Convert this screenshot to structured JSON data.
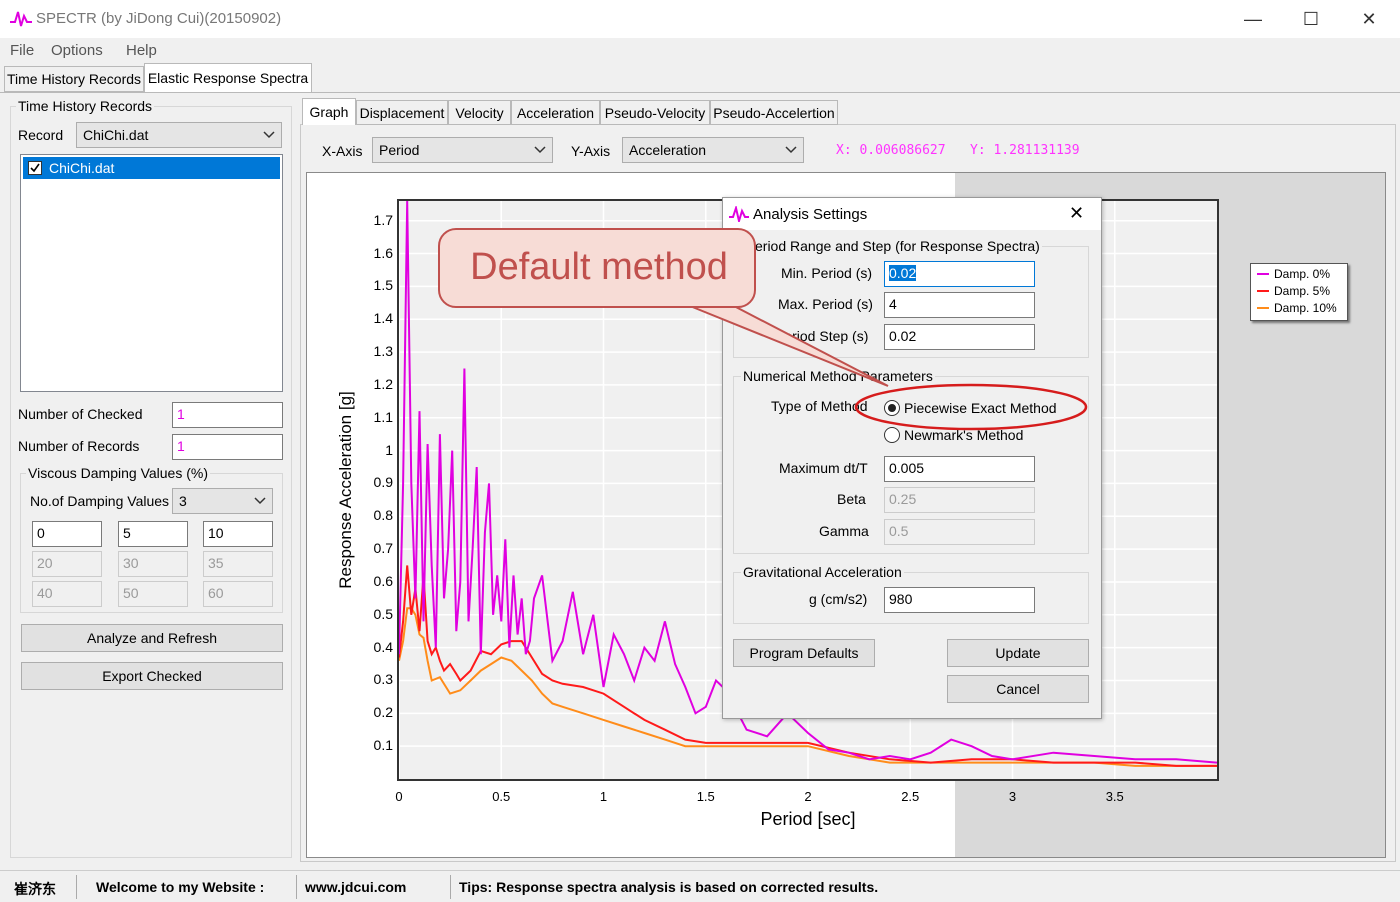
{
  "window": {
    "title": "SPECTR (by JiDong Cui)(20150902)",
    "minimize": "—",
    "maximize": "☐",
    "close": "✕"
  },
  "menu": [
    "File",
    "Options",
    "Help"
  ],
  "top_tabs": [
    "Time History Records",
    "Elastic Response Spectra"
  ],
  "left_panel": {
    "group_title": "Time History Records",
    "record_label": "Record",
    "record_value": "ChiChi.dat",
    "list_items": [
      {
        "label": "ChiChi.dat",
        "checked": true
      }
    ],
    "num_checked_label": "Number of Checked",
    "num_checked_value": "1",
    "num_records_label": "Number of Records",
    "num_records_value": "1",
    "damping_group_title": "Viscous Damping Values (%)",
    "no_damping_label": "No.of Damping Values",
    "no_damping_value": "3",
    "damping_values": [
      "0",
      "5",
      "10",
      "20",
      "30",
      "35",
      "40",
      "50",
      "60"
    ],
    "analyze_button": "Analyze and Refresh",
    "export_button": "Export Checked"
  },
  "graph_tabs": [
    "Graph",
    "Displacement",
    "Velocity",
    "Acceleration",
    "Pseudo-Velocity",
    "Pseudo-Accelertion"
  ],
  "axis_selectors": {
    "x_label": "X-Axis",
    "x_value": "Period",
    "y_label": "Y-Axis",
    "y_value": "Acceleration",
    "x_readout": "X: 0.006086627",
    "y_readout": "Y: 1.281131139",
    "readout_color": "#ff33ff"
  },
  "chart_data": {
    "type": "line",
    "xlabel": "Period [sec]",
    "ylabel": "Response Acceleration [g]",
    "xlim": [
      0,
      4
    ],
    "ylim": [
      0,
      1.76
    ],
    "x_ticks": [
      "0",
      "0.5",
      "1",
      "1.5",
      "2",
      "2.5",
      "3",
      "3.5"
    ],
    "y_ticks": [
      "0.1",
      "0.2",
      "0.3",
      "0.4",
      "0.5",
      "0.6",
      "0.7",
      "0.8",
      "0.9",
      "1",
      "1.1",
      "1.2",
      "1.3",
      "1.4",
      "1.5",
      "1.6",
      "1.7"
    ],
    "legend_position": "right",
    "series": [
      {
        "name": "Damp. 0%",
        "color": "#e000e0",
        "x": [
          0.0,
          0.02,
          0.04,
          0.06,
          0.08,
          0.1,
          0.12,
          0.14,
          0.16,
          0.18,
          0.2,
          0.22,
          0.24,
          0.26,
          0.28,
          0.3,
          0.32,
          0.34,
          0.36,
          0.38,
          0.4,
          0.42,
          0.44,
          0.46,
          0.48,
          0.5,
          0.52,
          0.54,
          0.56,
          0.58,
          0.6,
          0.62,
          0.64,
          0.66,
          0.7,
          0.75,
          0.8,
          0.85,
          0.9,
          0.95,
          1.0,
          1.05,
          1.1,
          1.15,
          1.2,
          1.25,
          1.3,
          1.35,
          1.4,
          1.45,
          1.5,
          1.55,
          1.6,
          1.7,
          1.8,
          1.9,
          2.0,
          2.1,
          2.2,
          2.3,
          2.4,
          2.5,
          2.6,
          2.7,
          2.8,
          2.9,
          3.0,
          3.2,
          3.4,
          3.6,
          3.8,
          4.0
        ],
        "y": [
          0.38,
          0.9,
          1.76,
          0.9,
          0.55,
          1.12,
          0.48,
          1.02,
          0.65,
          0.4,
          1.05,
          0.55,
          0.7,
          1.0,
          0.45,
          0.6,
          1.25,
          0.48,
          0.7,
          0.95,
          0.38,
          0.75,
          0.9,
          0.5,
          0.62,
          0.48,
          0.73,
          0.4,
          0.62,
          0.44,
          0.55,
          0.38,
          0.42,
          0.55,
          0.62,
          0.36,
          0.42,
          0.57,
          0.38,
          0.5,
          0.28,
          0.44,
          0.38,
          0.3,
          0.4,
          0.36,
          0.48,
          0.35,
          0.28,
          0.2,
          0.22,
          0.3,
          0.27,
          0.15,
          0.13,
          0.2,
          0.14,
          0.09,
          0.08,
          0.06,
          0.07,
          0.06,
          0.08,
          0.12,
          0.1,
          0.07,
          0.06,
          0.08,
          0.07,
          0.06,
          0.06,
          0.05
        ]
      },
      {
        "name": "Damp. 5%",
        "color": "#ff1a1a",
        "x": [
          0.0,
          0.02,
          0.04,
          0.06,
          0.08,
          0.1,
          0.12,
          0.14,
          0.16,
          0.18,
          0.2,
          0.22,
          0.25,
          0.28,
          0.3,
          0.35,
          0.4,
          0.45,
          0.5,
          0.55,
          0.6,
          0.65,
          0.7,
          0.75,
          0.8,
          0.9,
          1.0,
          1.1,
          1.2,
          1.3,
          1.4,
          1.5,
          1.6,
          1.8,
          2.0,
          2.2,
          2.4,
          2.6,
          2.8,
          3.0,
          3.2,
          3.4,
          3.6,
          3.8,
          4.0
        ],
        "y": [
          0.37,
          0.48,
          0.65,
          0.5,
          0.58,
          0.45,
          0.62,
          0.42,
          0.38,
          0.4,
          0.36,
          0.33,
          0.35,
          0.32,
          0.3,
          0.33,
          0.39,
          0.38,
          0.41,
          0.42,
          0.42,
          0.37,
          0.32,
          0.3,
          0.29,
          0.28,
          0.26,
          0.22,
          0.18,
          0.15,
          0.12,
          0.11,
          0.11,
          0.11,
          0.11,
          0.08,
          0.06,
          0.05,
          0.06,
          0.06,
          0.05,
          0.05,
          0.05,
          0.04,
          0.04
        ]
      },
      {
        "name": "Damp. 10%",
        "color": "#ff8c1a",
        "x": [
          0.0,
          0.02,
          0.04,
          0.06,
          0.08,
          0.1,
          0.12,
          0.14,
          0.16,
          0.2,
          0.25,
          0.3,
          0.35,
          0.4,
          0.45,
          0.5,
          0.55,
          0.6,
          0.65,
          0.7,
          0.75,
          0.8,
          0.9,
          1.0,
          1.1,
          1.2,
          1.3,
          1.4,
          1.5,
          1.6,
          1.8,
          2.0,
          2.2,
          2.4,
          2.6,
          2.8,
          3.0,
          3.2,
          3.4,
          3.6,
          3.8,
          4.0
        ],
        "y": [
          0.36,
          0.42,
          0.52,
          0.52,
          0.5,
          0.44,
          0.43,
          0.36,
          0.3,
          0.31,
          0.26,
          0.27,
          0.3,
          0.33,
          0.35,
          0.37,
          0.36,
          0.33,
          0.3,
          0.26,
          0.23,
          0.22,
          0.2,
          0.18,
          0.16,
          0.14,
          0.12,
          0.1,
          0.1,
          0.1,
          0.1,
          0.1,
          0.07,
          0.05,
          0.05,
          0.05,
          0.05,
          0.05,
          0.05,
          0.04,
          0.04,
          0.04
        ]
      }
    ]
  },
  "dialog": {
    "title": "Analysis Settings",
    "close": "✕",
    "period_group": "eriod Range and Step (for Response Spectra)",
    "min_period_label": "Min. Period (s)",
    "min_period_value": "0.02",
    "max_period_label": "Max. Period (s)",
    "max_period_value": "4",
    "period_step_label": "Period Step  (s)",
    "period_step_value": "0.02",
    "numerical_group": "Numerical Method Parameters",
    "type_of_method_label": "Type of Method",
    "method_options": [
      {
        "label": "Piecewise Exact Method",
        "selected": true
      },
      {
        "label": "Newmark's Method",
        "selected": false
      }
    ],
    "max_dt_label": "Maximum dt/T",
    "max_dt_value": "0.005",
    "beta_label": "Beta",
    "beta_value": "0.25",
    "gamma_label": "Gamma",
    "gamma_value": "0.5",
    "grav_group": "Gravitational Acceleration",
    "g_label": "g (cm/s2)",
    "g_value": "980",
    "program_defaults_button": "Program Defaults",
    "update_button": "Update",
    "cancel_button": "Cancel"
  },
  "annotation": {
    "callout_text": "Default method",
    "color": "#c0504d"
  },
  "statusbar": {
    "author": "崔济东",
    "welcome": "Welcome to my Website :",
    "website": "www.jdcui.com",
    "tips": "Tips: Response spectra analysis is based on corrected results."
  }
}
